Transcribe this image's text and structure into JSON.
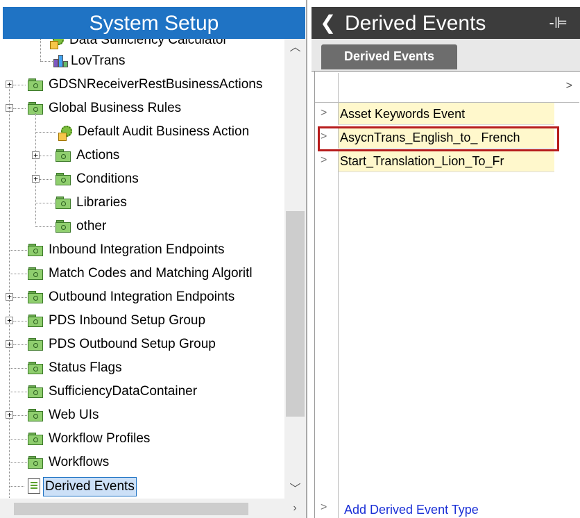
{
  "left_panel": {
    "title": "System Setup",
    "tree": [
      {
        "label": "Data Sufficiency Calculator",
        "icon": "calculator-icon"
      },
      {
        "label": "LovTrans",
        "icon": "bars-icon"
      },
      {
        "label": "GDSNReceiverRestBusinessActions",
        "icon": "folder-icon"
      },
      {
        "label": "Global Business Rules",
        "icon": "folder-icon"
      },
      {
        "label": "Default Audit Business Action",
        "icon": "gear-icon"
      },
      {
        "label": "Actions",
        "icon": "folder-icon"
      },
      {
        "label": "Conditions",
        "icon": "folder-icon"
      },
      {
        "label": "Libraries",
        "icon": "folder-icon"
      },
      {
        "label": "other",
        "icon": "folder-icon"
      },
      {
        "label": "Inbound Integration Endpoints",
        "icon": "folder-icon"
      },
      {
        "label": "Match Codes and Matching Algoritl",
        "icon": "folder-icon"
      },
      {
        "label": "Outbound Integration Endpoints",
        "icon": "folder-icon"
      },
      {
        "label": "PDS Inbound Setup Group",
        "icon": "folder-icon"
      },
      {
        "label": "PDS Outbound Setup Group",
        "icon": "folder-icon"
      },
      {
        "label": "Status Flags",
        "icon": "folder-icon"
      },
      {
        "label": "SufficiencyDataContainer",
        "icon": "folder-icon"
      },
      {
        "label": "Web UIs",
        "icon": "folder-icon"
      },
      {
        "label": "Workflow Profiles",
        "icon": "folder-icon"
      },
      {
        "label": "Workflows",
        "icon": "folder-icon"
      },
      {
        "label": "Derived Events",
        "icon": "document-list-icon"
      }
    ]
  },
  "right_panel": {
    "title": "Derived Events",
    "tab_label": "Derived Events",
    "rows": [
      {
        "label": "Asset Keywords Event"
      },
      {
        "label": "AsycnTrans_English_to_ French"
      },
      {
        "label": "Start_Translation_Lion_To_Fr"
      }
    ],
    "add_link": "Add Derived Event Type"
  },
  "colors": {
    "header_blue": "#1f73c4",
    "header_dark": "#3c3c3c",
    "row_highlight": "#fff8cc",
    "selection_outline": "#b71c1c",
    "link": "#1a2fd6"
  }
}
